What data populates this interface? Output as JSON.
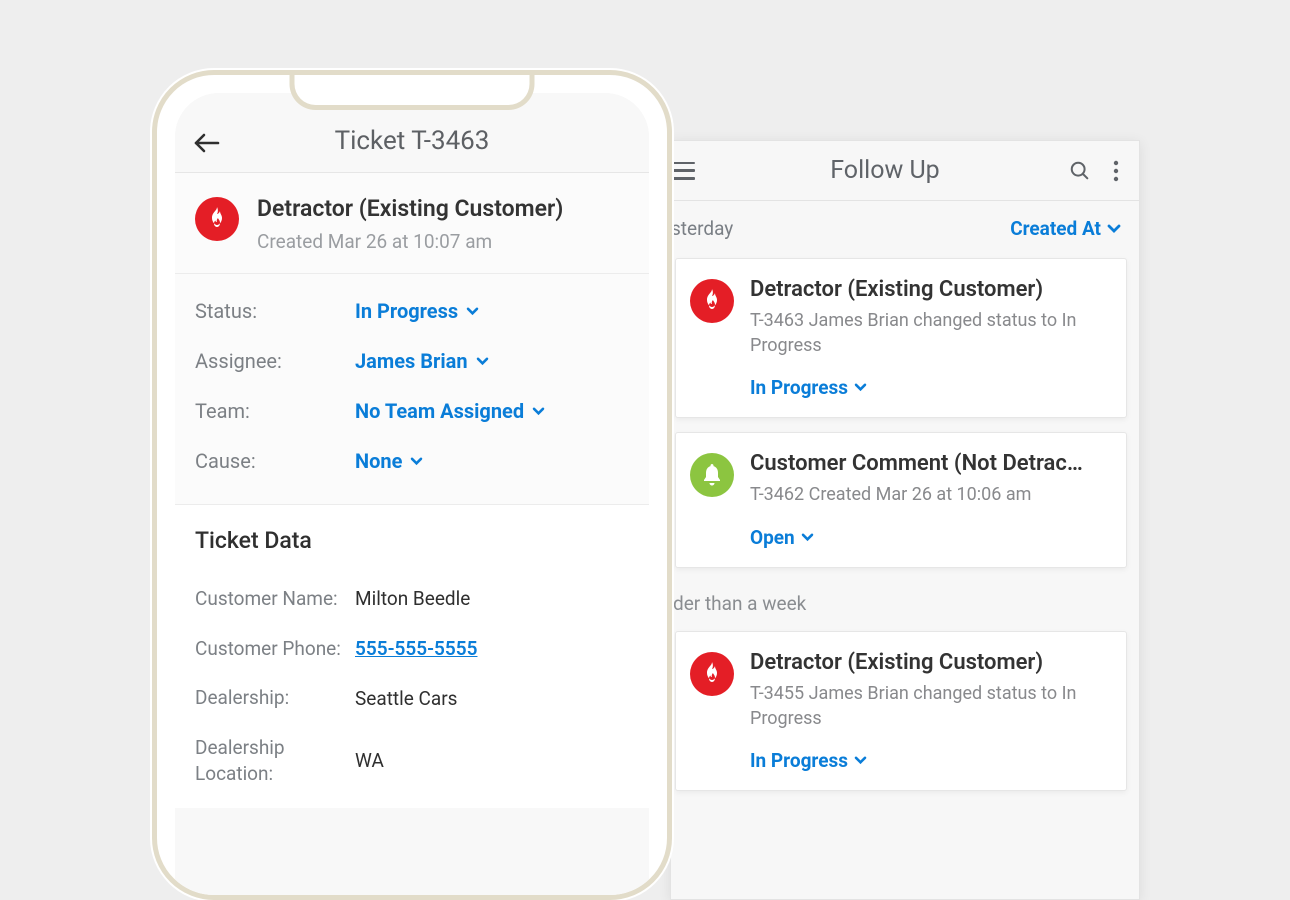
{
  "colors": {
    "accent": "#0a7dd8",
    "danger": "#e41e26",
    "ok": "#8cc540"
  },
  "phone1": {
    "header_title": "Ticket T-3463",
    "intro": {
      "icon": "fire-icon",
      "title": "Detractor (Existing Customer)",
      "created": "Created Mar 26 at 10:07 am"
    },
    "props": {
      "status_label": "Status:",
      "status_value": "In Progress",
      "assignee_label": "Assignee:",
      "assignee_value": "James Brian",
      "team_label": "Team:",
      "team_value": "No Team Assigned",
      "cause_label": "Cause:",
      "cause_value": "None"
    },
    "data_section_title": "Ticket Data",
    "data": {
      "customer_name_label": "Customer Name:",
      "customer_name_value": "Milton Beedle",
      "customer_phone_label": "Customer Phone:",
      "customer_phone_value": "555-555-5555",
      "dealership_label": "Dealership:",
      "dealership_value": "Seattle Cars",
      "dealership_loc_label": "Dealership Location:",
      "dealership_loc_value": "WA"
    }
  },
  "phone2": {
    "header_title": "Follow Up",
    "section_yesterday": "sterday",
    "sort_label": "Created At",
    "cards": [
      {
        "icon": "fire-icon",
        "title": "Detractor (Existing Customer)",
        "sub": "T-3463 James Brian changed status to In Progress",
        "status": "In Progress"
      },
      {
        "icon": "bell-icon",
        "title": "Customer Comment (Not Detrac…",
        "sub": "T-3462 Created Mar 26 at 10:06 am",
        "status": "Open"
      }
    ],
    "section_older": "der than a week",
    "older_card": {
      "icon": "fire-icon",
      "title": "Detractor (Existing Customer)",
      "sub": "T-3455 James Brian changed status to In Progress",
      "status": "In Progress"
    }
  }
}
